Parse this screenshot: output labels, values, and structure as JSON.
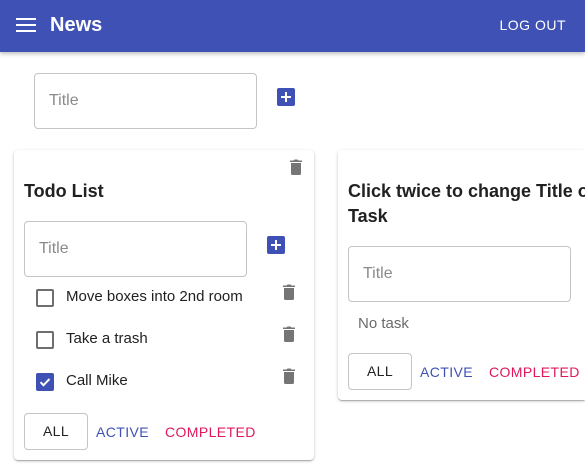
{
  "appbar": {
    "title": "News",
    "logout_label": "LOG OUT"
  },
  "new_list": {
    "placeholder": "Title",
    "add_icon": "add-box-icon"
  },
  "lists": [
    {
      "title": "Todo List",
      "input_placeholder": "Title",
      "tasks": [
        {
          "label": "Move boxes into 2nd room",
          "checked": false
        },
        {
          "label": "Take a trash",
          "checked": false
        },
        {
          "label": "Call Mike",
          "checked": true
        }
      ],
      "filters": {
        "all": "ALL",
        "active": "ACTIVE",
        "completed": "COMPLETED"
      }
    },
    {
      "title": "Click twice to change Title of Task",
      "input_placeholder": "Title",
      "empty_text": "No task",
      "filters": {
        "all": "ALL",
        "active": "ACTIVE",
        "completed": "COMPLETED"
      }
    }
  ],
  "colors": {
    "primary": "#3f51b5",
    "secondary": "#e0185b",
    "icon_gray": "#757575"
  }
}
